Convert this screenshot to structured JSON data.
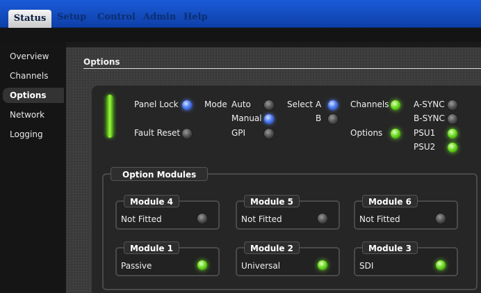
{
  "menu": {
    "tabs": [
      {
        "label": "Status",
        "active": true
      },
      {
        "label": "Setup"
      },
      {
        "label": "Control"
      },
      {
        "label": "Admin"
      },
      {
        "label": "Help"
      }
    ]
  },
  "sidebar": {
    "items": [
      {
        "label": "Overview"
      },
      {
        "label": "Channels"
      },
      {
        "label": "Options",
        "active": true
      },
      {
        "label": "Network"
      },
      {
        "label": "Logging"
      }
    ]
  },
  "main": {
    "section_title": "Options",
    "panel": {
      "panel_lock": {
        "label": "Panel Lock",
        "state": "blue"
      },
      "fault_reset": {
        "label": "Fault Reset",
        "state": "off"
      },
      "mode": {
        "label": "Mode",
        "options": [
          {
            "label": "Auto",
            "state": "off"
          },
          {
            "label": "Manual",
            "state": "blue"
          },
          {
            "label": "GPI",
            "state": "off"
          }
        ]
      },
      "select": {
        "label": "Select",
        "options": [
          {
            "label": "A",
            "state": "blue"
          },
          {
            "label": "B",
            "state": "off"
          }
        ]
      },
      "channels": {
        "label": "Channels",
        "state": "green"
      },
      "options": {
        "label": "Options",
        "state": "green"
      },
      "sync": [
        {
          "label": "A-SYNC",
          "state": "off"
        },
        {
          "label": "B-SYNC",
          "state": "off"
        }
      ],
      "psu": [
        {
          "label": "PSU1",
          "state": "green"
        },
        {
          "label": "PSU2",
          "state": "green"
        }
      ]
    },
    "option_modules": {
      "title": "Option Modules",
      "modules": [
        {
          "title": "Module 4",
          "status": "Not Fitted",
          "state": "off"
        },
        {
          "title": "Module 5",
          "status": "Not Fitted",
          "state": "off"
        },
        {
          "title": "Module 6",
          "status": "Not Fitted",
          "state": "off"
        },
        {
          "title": "Module 1",
          "status": "Passive",
          "state": "green"
        },
        {
          "title": "Module 2",
          "status": "Universal",
          "state": "green"
        },
        {
          "title": "Module 3",
          "status": "SDI",
          "state": "green"
        }
      ]
    }
  },
  "colors": {
    "menubar": "#1a5bd8",
    "led_green": "#6cdc22",
    "led_blue": "#4f7ff5",
    "led_off": "#4a4a4a"
  }
}
